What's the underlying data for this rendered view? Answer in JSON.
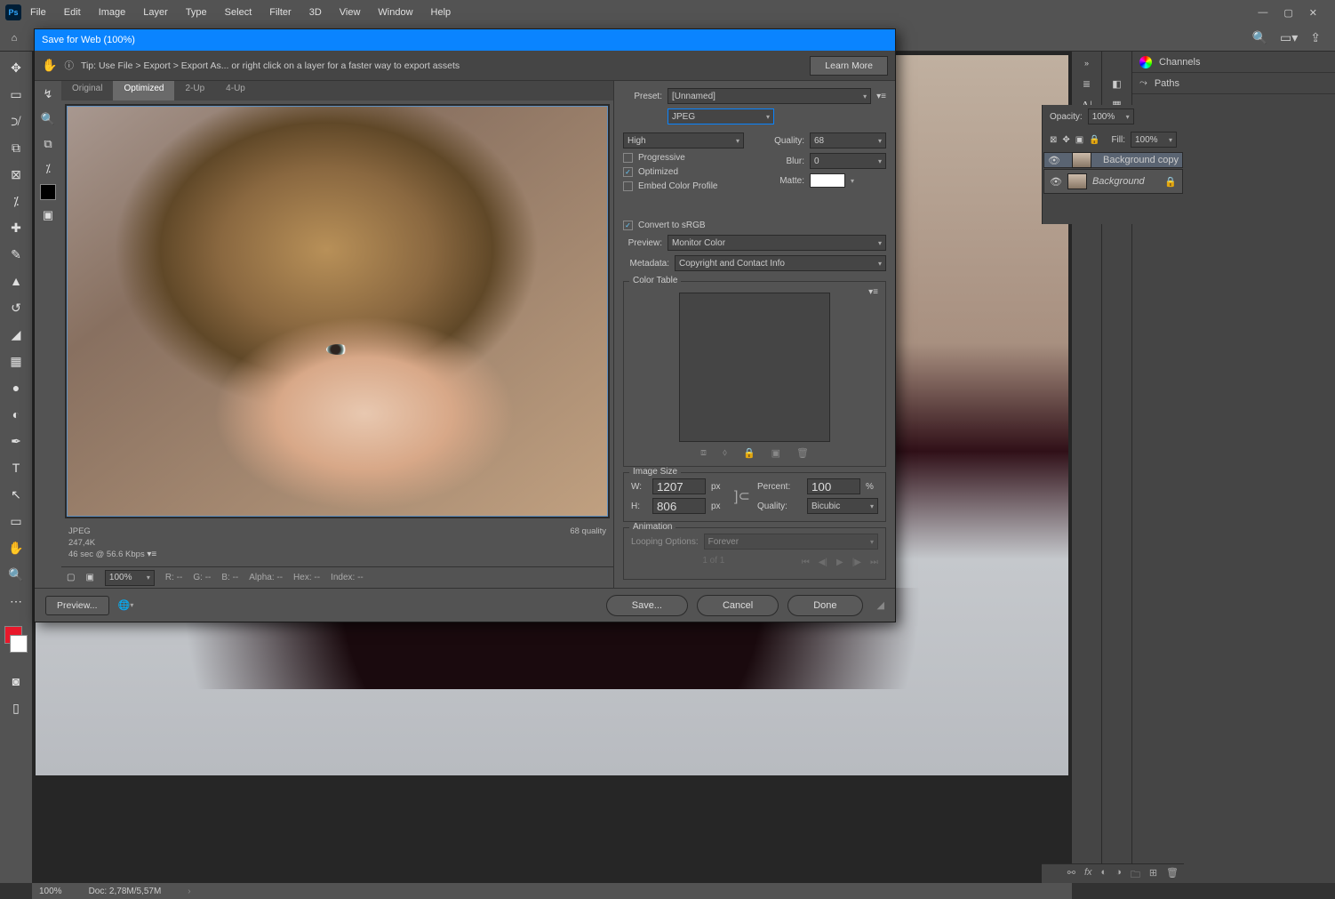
{
  "menu": {
    "items": [
      "File",
      "Edit",
      "Image",
      "Layer",
      "Type",
      "Select",
      "Filter",
      "3D",
      "View",
      "Window",
      "Help"
    ]
  },
  "dialog": {
    "title": "Save for Web (100%)",
    "tip": "Tip: Use File > Export > Export As... or right click on a layer for a faster way to export assets",
    "learn_more": "Learn More",
    "tabs": [
      "Original",
      "Optimized",
      "2-Up",
      "4-Up"
    ],
    "active_tab": "Optimized",
    "info": {
      "format": "JPEG",
      "size": "247,4K",
      "time": "46 sec @ 56.6 Kbps",
      "quality_text": "68 quality"
    },
    "zoom": "100%",
    "readouts": {
      "r": "R: --",
      "g": "G: --",
      "b": "B: --",
      "alpha": "Alpha: --",
      "hex": "Hex: --",
      "index": "Index: --"
    },
    "preset_label": "Preset:",
    "preset": "[Unnamed]",
    "format": "JPEG",
    "quality_preset": "High",
    "progressive": "Progressive",
    "optimized": "Optimized",
    "embed": "Embed Color Profile",
    "quality_label": "Quality:",
    "quality": "68",
    "blur_label": "Blur:",
    "blur": "0",
    "matte_label": "Matte:",
    "convert": "Convert to sRGB",
    "preview_label": "Preview:",
    "preview_val": "Monitor Color",
    "metadata_label": "Metadata:",
    "metadata_val": "Copyright and Contact Info",
    "color_table": "Color Table",
    "image_size": "Image Size",
    "w_label": "W:",
    "w": "1207",
    "px": "px",
    "h_label": "H:",
    "h": "806",
    "percent_label": "Percent:",
    "percent": "100",
    "pct": "%",
    "qlabel2": "Quality:",
    "resample": "Bicubic",
    "animation": "Animation",
    "loop_label": "Looping Options:",
    "loop_val": "Forever",
    "frame_range": "1 of 1",
    "buttons": {
      "preview": "Preview...",
      "save": "Save...",
      "cancel": "Cancel",
      "done": "Done"
    }
  },
  "layers": {
    "opacity_label": "Opacity:",
    "opacity": "100%",
    "fill_label": "Fill:",
    "fill": "100%",
    "items": [
      {
        "name": "Background copy",
        "locked": false
      },
      {
        "name": "Background",
        "locked": true
      }
    ]
  },
  "panels_right": {
    "channels": "Channels",
    "paths": "Paths"
  },
  "status": {
    "zoom": "100%",
    "doc": "Doc: 2,78M/5,57M"
  }
}
